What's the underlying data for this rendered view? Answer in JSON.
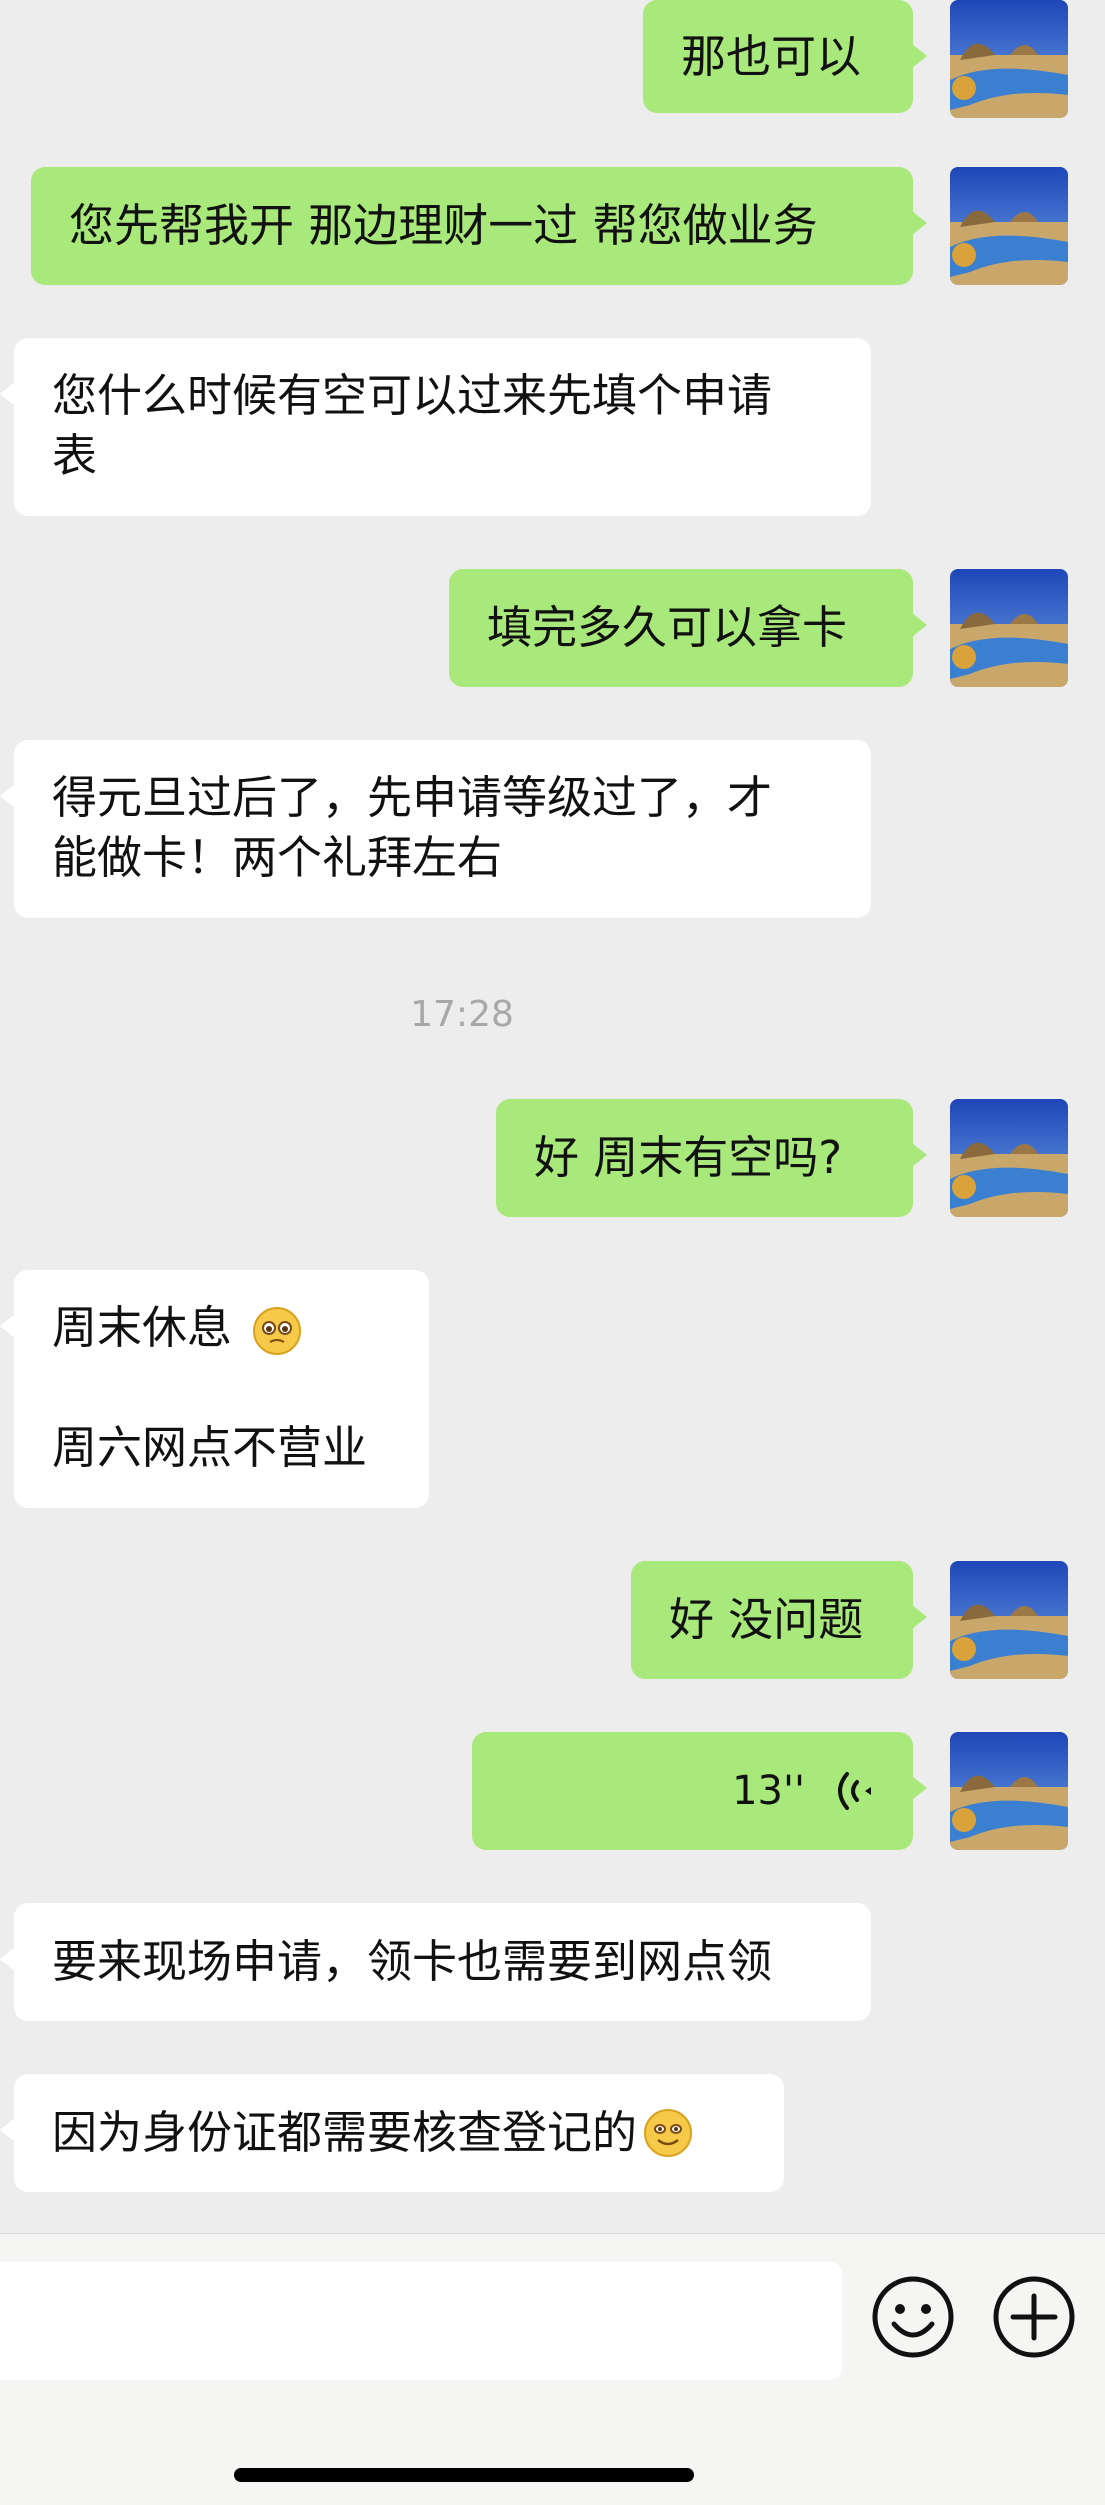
{
  "chat": {
    "messages": [
      {
        "id": "m1",
        "side": "out",
        "text": "那也可以"
      },
      {
        "id": "m2",
        "side": "out",
        "text": "您先帮我开 那边理财一过 帮您做业务"
      },
      {
        "id": "m3",
        "side": "in",
        "lines": [
          "您什么时候有空可以过来先填个申请",
          "表"
        ]
      },
      {
        "id": "m4",
        "side": "out",
        "text": "填完多久可以拿卡"
      },
      {
        "id": "m5",
        "side": "in",
        "lines": [
          "得元旦过后了，先申请等级过了，才",
          "能做卡！两个礼拜左右"
        ]
      },
      {
        "id": "m6",
        "side": "out",
        "text": "好 周末有空吗?"
      },
      {
        "id": "m7",
        "side": "in",
        "lines": [
          "周末休息",
          "周六网点不营业"
        ],
        "emoji": "pleading-face-emoji"
      },
      {
        "id": "m8",
        "side": "out",
        "text": "好 没问题"
      },
      {
        "id": "m9",
        "side": "out",
        "type": "voice",
        "duration": "13''"
      },
      {
        "id": "m10",
        "side": "in",
        "text": "要来现场申请，领卡也需要到网点领"
      },
      {
        "id": "m11",
        "side": "in",
        "text": "因为身份证都需要核查登记的",
        "emoji": "smiling-face-emoji"
      }
    ],
    "timestamp": "17:28"
  },
  "icons": {
    "avatar": "beach-landscape-avatar",
    "voice": "voice-wave-icon",
    "emoji_button": "emoji-icon",
    "plus_button": "plus-icon"
  },
  "colors": {
    "outgoing_bubble": "#a9e87a",
    "incoming_bubble": "#ffffff",
    "background": "#ededed"
  }
}
